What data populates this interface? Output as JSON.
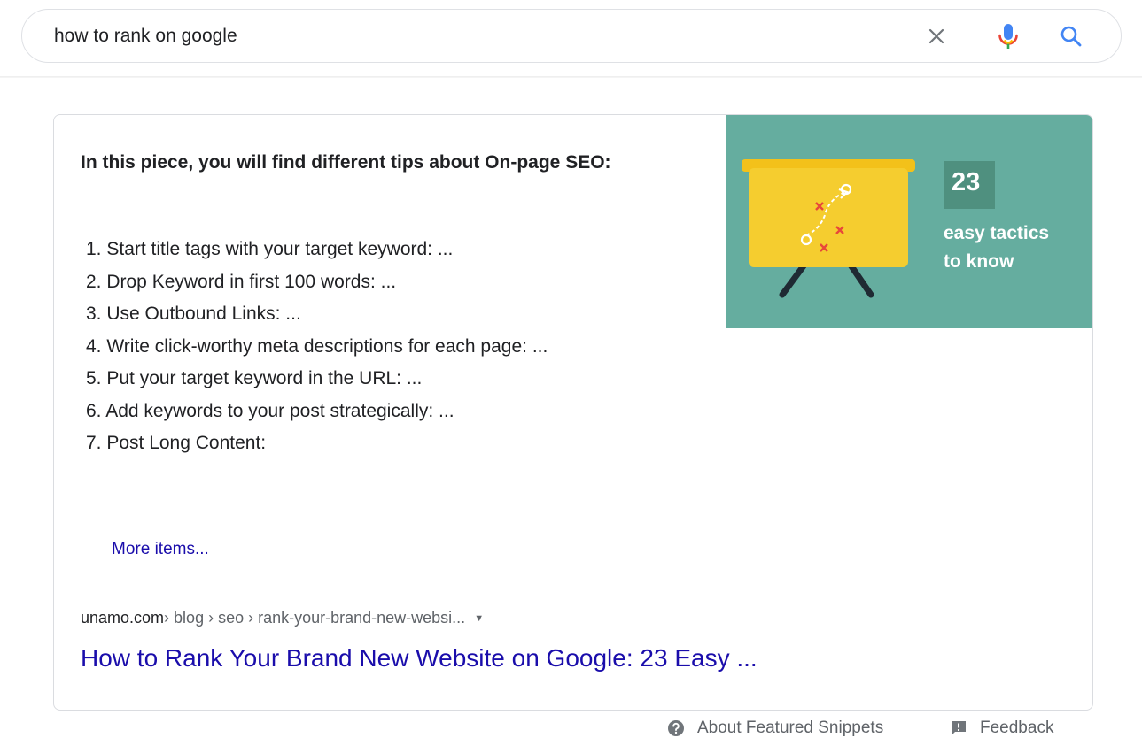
{
  "search": {
    "query": "how to rank on google",
    "clear_icon": "close-icon",
    "mic_icon": "microphone-icon",
    "search_icon": "search-icon"
  },
  "snippet": {
    "heading": "In this piece, you will find different tips about On-page SEO:",
    "items": [
      "1. Start title tags with your target keyword: ...",
      "2. Drop Keyword in first 100 words: ...",
      "3. Use Outbound Links: ...",
      "4. Write click-worthy meta descriptions for each page: ...",
      "5. Put your target keyword in the URL: ...",
      "6. Add keywords to your post strategically: ...",
      "7. Post Long Content:"
    ],
    "more_items": "More items...",
    "breadcrumb": {
      "domain": "unamo.com",
      "path": " › blog › seo › rank-your-brand-new-websi...",
      "caret": "▼"
    },
    "result_title": "How to Rank Your Brand New Website on Google: 23 Easy ...",
    "thumbnail": {
      "number": "23",
      "line1": "easy tactics",
      "line2": "to know",
      "background_color": "#65ad9f"
    }
  },
  "footer": {
    "about_label": "About Featured Snippets",
    "feedback_label": "Feedback"
  },
  "colors": {
    "link": "#1a0dab",
    "text": "#202124",
    "muted": "#5f6368",
    "google_blue": "#4285f4"
  }
}
